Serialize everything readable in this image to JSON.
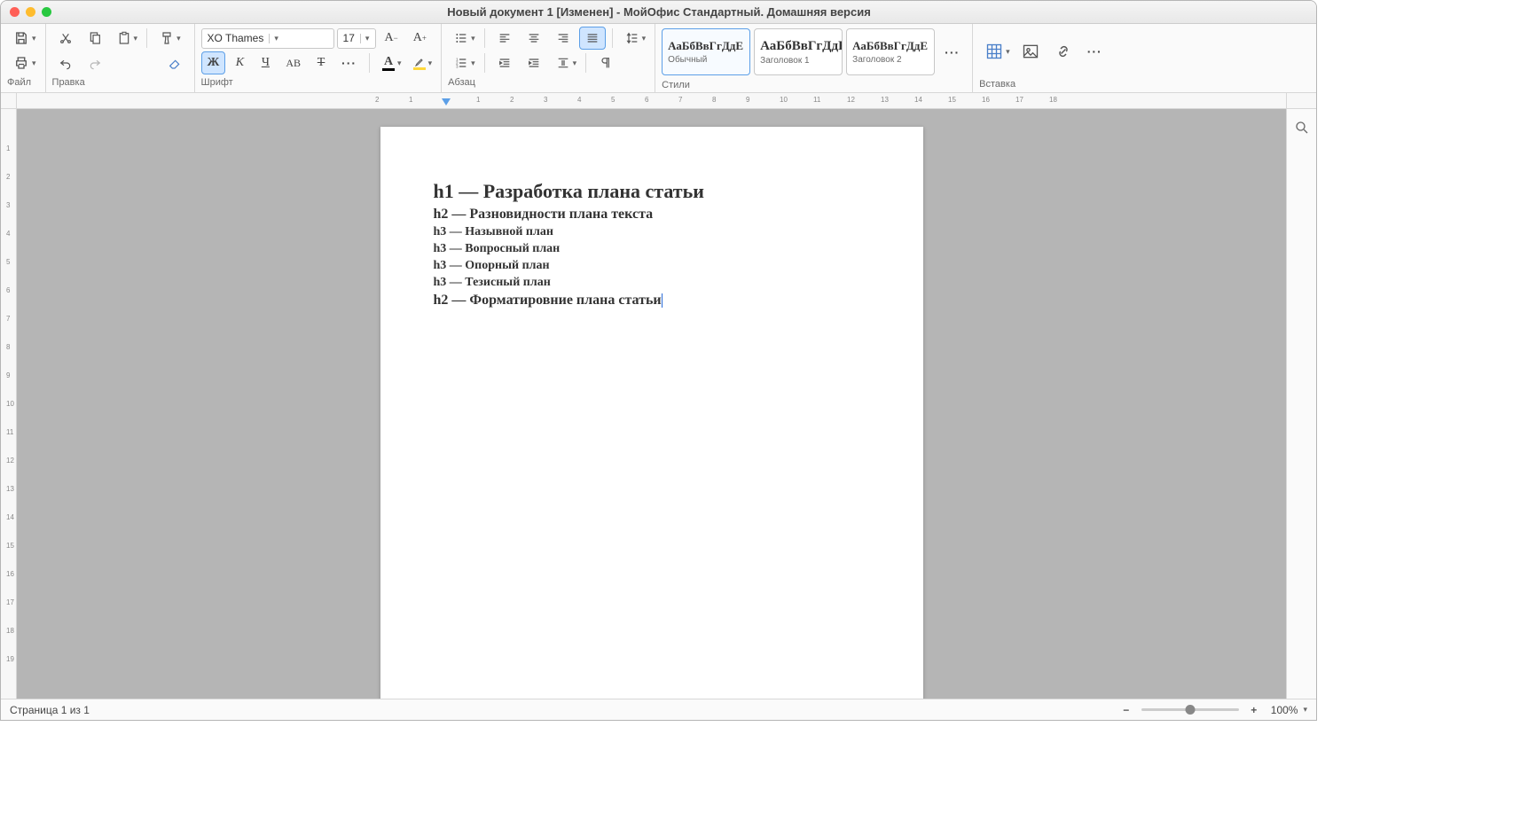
{
  "window": {
    "title": "Новый документ 1 [Изменен] - МойОфис Стандартный. Домашняя версия"
  },
  "ribbon": {
    "file_label": "Файл",
    "edit_label": "Правка",
    "font_label": "Шрифт",
    "paragraph_label": "Абзац",
    "styles_label": "Стили",
    "insert_label": "Вставка",
    "font_name": "XO Thames",
    "font_size": "17",
    "style_preview": "АаБбВвГгДдЕ",
    "style_names": {
      "normal": "Обычный",
      "h1": "Заголовок 1",
      "h2": "Заголовок 2"
    }
  },
  "ruler": {
    "hmarks": [
      "2",
      "1",
      "",
      "1",
      "2",
      "3",
      "4",
      "5",
      "6",
      "7",
      "8",
      "9",
      "10",
      "11",
      "12",
      "13",
      "14",
      "15",
      "16",
      "17",
      "18"
    ],
    "vmarks": [
      "1",
      "2",
      "3",
      "4",
      "5",
      "6",
      "7",
      "8",
      "9",
      "10",
      "11",
      "12",
      "13",
      "14",
      "15",
      "16",
      "17",
      "18",
      "19"
    ]
  },
  "document": {
    "h1": "h1 — Разработка плана статьи",
    "l2": "h2 — Разновидности плана текста",
    "l3": "h3 — Назывной план",
    "l4": "h3 — Вопросный план",
    "l5": "h3 — Опорный план",
    "l6": "h3 — Тезисный план",
    "l7": "h2 — Форматировние плана статьи"
  },
  "status": {
    "page": "Страница 1 из 1",
    "zoom": "100%"
  }
}
